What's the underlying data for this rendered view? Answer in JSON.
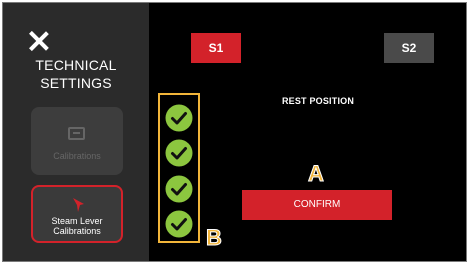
{
  "sidebar": {
    "title_line1": "TECHNICAL",
    "title_line2": "SETTINGS",
    "items": [
      {
        "label": "Calibrations",
        "icon": "tray-icon",
        "state": "disabled"
      },
      {
        "label_line1": "Steam Lever",
        "label_line2": "Calibrations",
        "icon": "steam-lever-icon",
        "state": "selected"
      }
    ]
  },
  "tabs": [
    {
      "label": "S1",
      "active": true
    },
    {
      "label": "S2",
      "active": false
    }
  ],
  "main": {
    "heading": "REST POSITION",
    "check_count": 4,
    "confirm_label": "CONFIRM"
  },
  "markers": {
    "a": "A",
    "b": "B"
  },
  "colors": {
    "accent_red": "#d3222a",
    "check_green": "#8cc63f",
    "marker_orange": "#f2b53a",
    "sidebar_bg": "#2b2b2b",
    "screen_bg": "#000000"
  }
}
